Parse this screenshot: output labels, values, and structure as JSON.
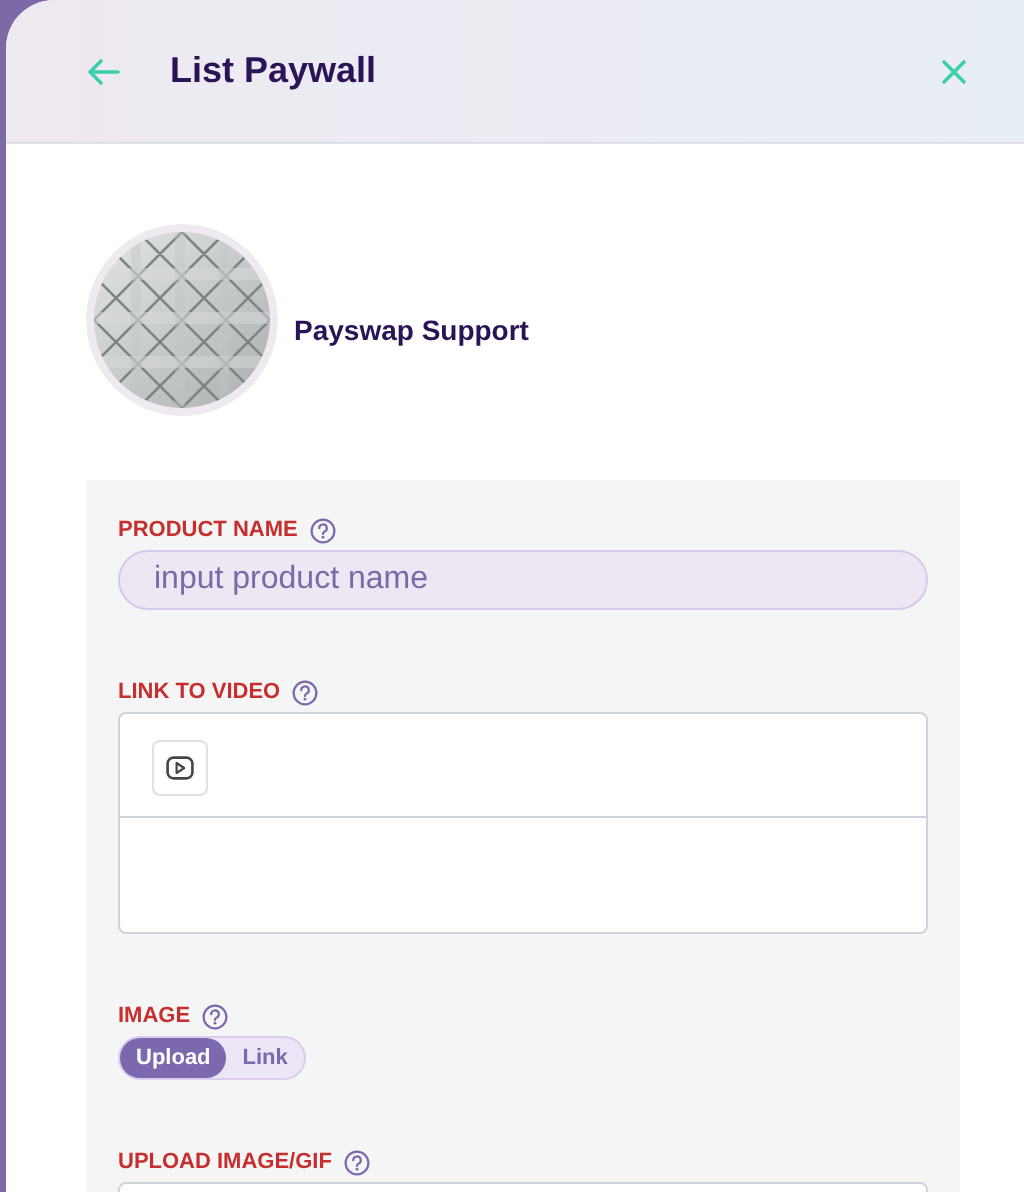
{
  "header": {
    "title": "List Paywall"
  },
  "profile": {
    "name": "Payswap Support"
  },
  "form": {
    "fields": [
      {
        "kind": "text",
        "label": "PRODUCT NAME",
        "placeholder": "input product name"
      },
      {
        "kind": "video",
        "label": "LINK TO VIDEO"
      },
      {
        "kind": "toggle",
        "label": "IMAGE",
        "options": [
          {
            "label": "Upload",
            "selected": true
          },
          {
            "label": "Link",
            "selected": false
          }
        ]
      },
      {
        "kind": "upload",
        "label": "UPLOAD IMAGE/GIF"
      }
    ]
  }
}
